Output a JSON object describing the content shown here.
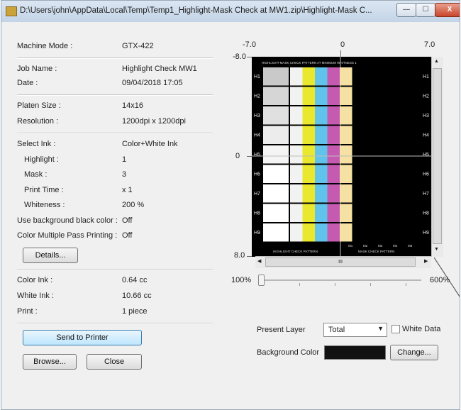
{
  "window": {
    "title": "D:\\Users\\john\\AppData\\Local\\Temp\\Temp1_Highlight-Mask Check at MW1.zip\\Highlight-Mask C...",
    "controls": {
      "minimize": "—",
      "maximize": "☐",
      "close": "X"
    }
  },
  "info": {
    "machine_mode": {
      "label": "Machine Mode :",
      "value": "GTX-422"
    },
    "job_name": {
      "label": "Job Name :",
      "value": "Highlight Check MW1"
    },
    "date": {
      "label": "Date :",
      "value": "09/04/2018 17:05"
    },
    "platen_size": {
      "label": "Platen Size :",
      "value": "14x16"
    },
    "resolution": {
      "label": "Resolution :",
      "value": "1200dpi x 1200dpi"
    },
    "select_ink": {
      "label": "Select Ink :",
      "value": "Color+White Ink"
    },
    "highlight": {
      "label": "Highlight :",
      "value": "1"
    },
    "mask": {
      "label": "Mask :",
      "value": "3"
    },
    "print_time": {
      "label": "Print Time :",
      "value": "x 1"
    },
    "whiteness": {
      "label": "Whiteness :",
      "value": "200 %"
    },
    "use_bg_black": {
      "label": "Use background black color :",
      "value": "Off"
    },
    "color_multi_pass": {
      "label": "Color Multiple Pass Printing :",
      "value": "Off"
    },
    "color_ink": {
      "label": "Color Ink :",
      "value": "0.64 cc"
    },
    "white_ink": {
      "label": "White Ink :",
      "value": "10.66 cc"
    },
    "print": {
      "label": "Print :",
      "value": "1 piece"
    }
  },
  "buttons": {
    "details": "Details...",
    "send_to_printer": "Send to Printer",
    "browse": "Browse...",
    "close": "Close",
    "change": "Change..."
  },
  "preview": {
    "x_axis": {
      "left": "-7.0",
      "center": "0",
      "right": "7.0"
    },
    "y_axis": {
      "top": "-8.0",
      "middle": "0",
      "bottom": "8.0"
    },
    "top_caption": "HIGHLIGHT-MASK CHECK PATTERN AT MINIMUM WHITNESS 1",
    "left_footer": "HIGHLIGHT CHECK PATTERN",
    "right_footer": "MASK CHECK PATTERN",
    "row_labels": [
      "H1",
      "H2",
      "H3",
      "H4",
      "H5",
      "H6",
      "H7",
      "H8",
      "H9"
    ],
    "mask_labels": [
      "M1",
      "M2",
      "M3",
      "M4",
      "M5"
    ],
    "swatch_colors": [
      "#f2f2f2",
      "#e9e82e",
      "#5fc3ec",
      "#c55bb1",
      "#f5e1a3"
    ],
    "grey_levels": [
      "#c9c9c9",
      "#d6d6d6",
      "#e0e0e0",
      "#ececec",
      "#f5f5f5",
      "#ffffff",
      "#ffffff",
      "#ffffff",
      "#ffffff"
    ],
    "scroll_glyph": "III"
  },
  "zoom": {
    "min_label": "100%",
    "max_label": "600%"
  },
  "layer": {
    "label": "Present Layer",
    "selected": "Total",
    "white_data_label": "White Data"
  },
  "background": {
    "label": "Background Color",
    "color": "#111111"
  }
}
